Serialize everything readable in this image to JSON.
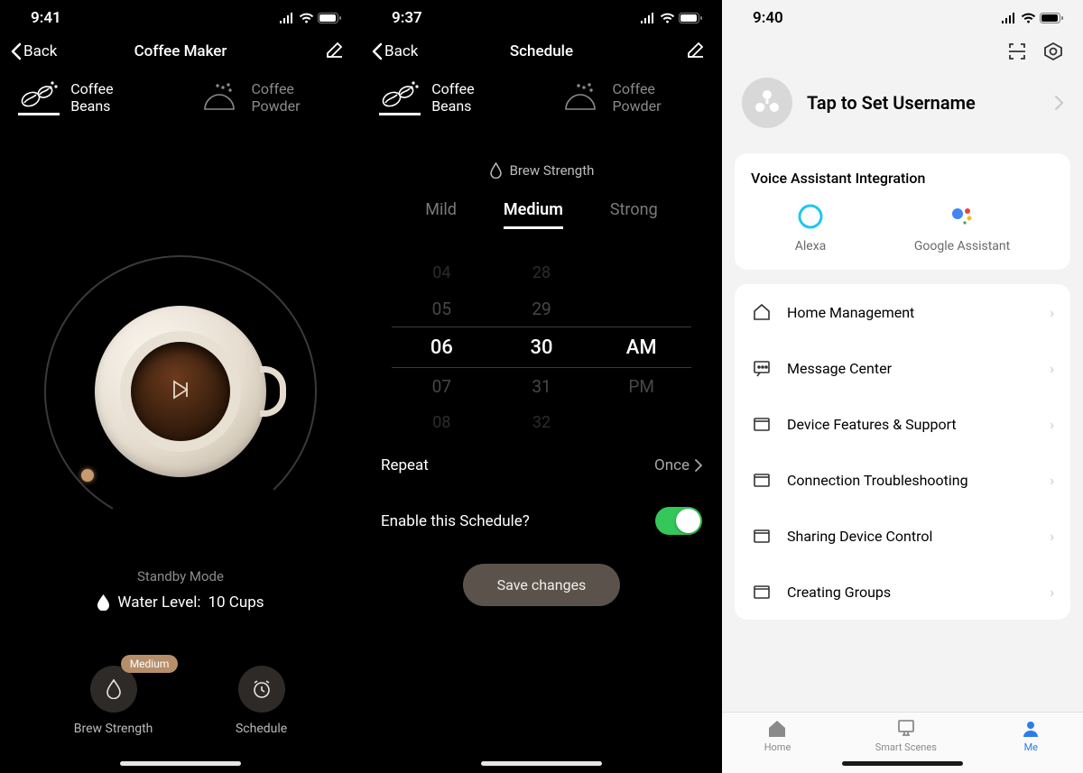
{
  "screen1": {
    "status_time": "9:41",
    "back": "Back",
    "title": "Coffee Maker",
    "tabs": {
      "beans": "Coffee Beans",
      "powder": "Coffee Powder"
    },
    "status_mode": "Standby Mode",
    "water_label": "Water Level:",
    "water_value": "10 Cups",
    "actions": {
      "brew": "Brew Strength",
      "schedule": "Schedule",
      "badge": "Medium"
    }
  },
  "screen2": {
    "status_time": "9:37",
    "back": "Back",
    "title": "Schedule",
    "tabs": {
      "beans": "Coffee Beans",
      "powder": "Coffee Powder"
    },
    "brew_strength_label": "Brew Strength",
    "strengths": {
      "mild": "Mild",
      "medium": "Medium",
      "strong": "Strong"
    },
    "picker": {
      "r0h": "04",
      "r0m": "28",
      "r1h": "05",
      "r1m": "29",
      "r2h": "06",
      "r2m": "30",
      "r2a": "AM",
      "r3h": "07",
      "r3m": "31",
      "r3a": "PM",
      "r4h": "08",
      "r4m": "32"
    },
    "repeat_label": "Repeat",
    "repeat_value": "Once",
    "enable_label": "Enable this Schedule?",
    "save": "Save changes"
  },
  "screen3": {
    "status_time": "9:40",
    "username": "Tap to Set Username",
    "voice_title": "Voice Assistant Integration",
    "alexa": "Alexa",
    "google": "Google Assistant",
    "items": {
      "home": "Home Management",
      "message": "Message Center",
      "faq": "Device Features & Support",
      "network": "Connection Troubleshooting",
      "sharing": "Sharing Device Control",
      "group": "Creating Groups"
    },
    "tabbar": {
      "home": "Home",
      "smart": "Smart Scenes",
      "me": "Me"
    }
  }
}
